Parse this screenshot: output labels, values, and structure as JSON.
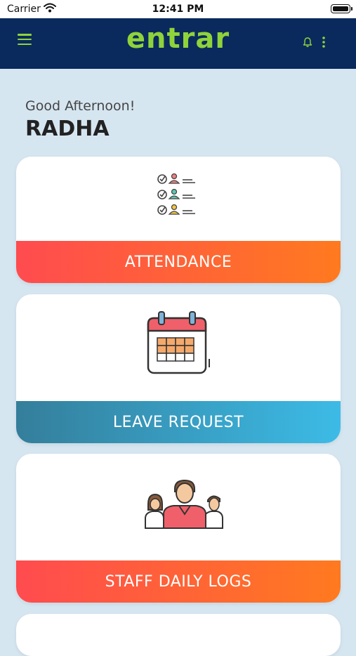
{
  "status_bar": {
    "carrier": "Carrier",
    "time": "12:41 PM"
  },
  "app_bar": {
    "logo": "entrar",
    "menu_icon": "hamburger-menu-icon",
    "notification_icon": "bell-icon",
    "more_icon": "more-vertical-icon",
    "accent_color": "#8fd33a",
    "background_color": "#0a2a5e"
  },
  "greeting": {
    "salutation": "Good Afternoon!",
    "name": "RADHA"
  },
  "cards": [
    {
      "label": "ATTENDANCE",
      "icon": "attendance-checklist-icon",
      "bar_color": "orange"
    },
    {
      "label": "LEAVE REQUEST",
      "icon": "calendar-icon",
      "bar_color": "blue"
    },
    {
      "label": "STAFF DAILY LOGS",
      "icon": "staff-group-icon",
      "bar_color": "orange"
    }
  ]
}
